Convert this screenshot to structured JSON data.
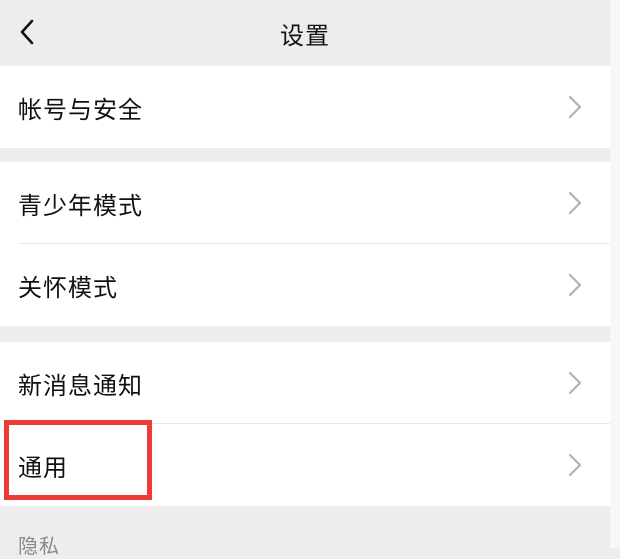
{
  "header": {
    "title": "设置",
    "back_icon": "chevron-left-icon"
  },
  "groups": [
    {
      "items": [
        {
          "label": "帐号与安全"
        }
      ]
    },
    {
      "items": [
        {
          "label": "青少年模式"
        },
        {
          "label": "关怀模式"
        }
      ]
    },
    {
      "items": [
        {
          "label": "新消息通知"
        },
        {
          "label": "通用"
        }
      ]
    }
  ],
  "section_caption": "隐私",
  "highlight": {
    "color": "#ef3a3a",
    "target": "通用"
  },
  "colors": {
    "background": "#ededed",
    "card": "#ffffff",
    "chevron": "#b2b2b2"
  }
}
